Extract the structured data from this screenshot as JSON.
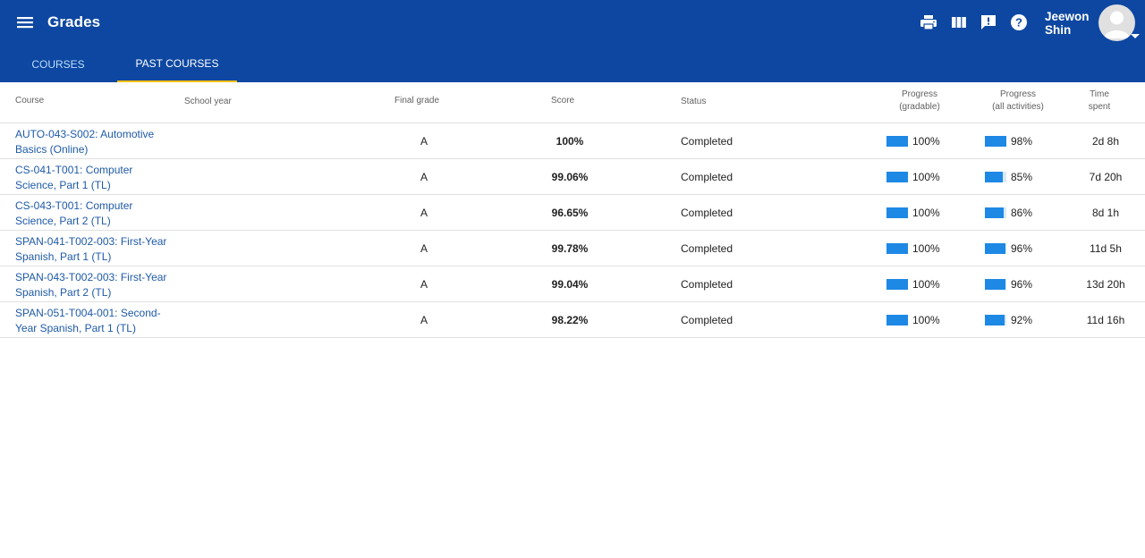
{
  "app": {
    "title": "Grades"
  },
  "header": {
    "icons": [
      "menu-icon",
      "print-icon",
      "columns-icon",
      "feedback-icon",
      "help-icon"
    ],
    "user": {
      "name_line1": "Jeewon",
      "name_line2": "Shin"
    }
  },
  "tabs": [
    {
      "label": "COURSES",
      "active": false
    },
    {
      "label": "PAST COURSES",
      "active": true
    }
  ],
  "columns": {
    "course": "Course",
    "school_year": "School year",
    "final_grade": "Final grade",
    "score": "Score",
    "status": "Status",
    "progress_gradable_1": "Progress",
    "progress_gradable_2": "(gradable)",
    "progress_all_1": "Progress",
    "progress_all_2": "(all activities)",
    "time_1": "Time",
    "time_2": "spent"
  },
  "rows": [
    {
      "course": "AUTO-043-S002: Automotive Basics (Online)",
      "grade": "A",
      "score": "100%",
      "status": "Completed",
      "prog_gradable": "100%",
      "prog_gradable_value": 100,
      "prog_all": "98%",
      "prog_all_value": 98,
      "time": "2d 8h"
    },
    {
      "course": "CS-041-T001: Computer Science, Part 1 (TL)",
      "grade": "A",
      "score": "99.06%",
      "status": "Completed",
      "prog_gradable": "100%",
      "prog_gradable_value": 100,
      "prog_all": "85%",
      "prog_all_value": 85,
      "time": "7d 20h"
    },
    {
      "course": "CS-043-T001: Computer Science, Part 2 (TL)",
      "grade": "A",
      "score": "96.65%",
      "status": "Completed",
      "prog_gradable": "100%",
      "prog_gradable_value": 100,
      "prog_all": "86%",
      "prog_all_value": 86,
      "time": "8d 1h"
    },
    {
      "course": "SPAN-041-T002-003: First-Year Spanish, Part 1 (TL)",
      "grade": "A",
      "score": "99.78%",
      "status": "Completed",
      "prog_gradable": "100%",
      "prog_gradable_value": 100,
      "prog_all": "96%",
      "prog_all_value": 96,
      "time": "11d 5h"
    },
    {
      "course": "SPAN-043-T002-003: First-Year Spanish, Part 2 (TL)",
      "grade": "A",
      "score": "99.04%",
      "status": "Completed",
      "prog_gradable": "100%",
      "prog_gradable_value": 100,
      "prog_all": "96%",
      "prog_all_value": 96,
      "time": "13d 20h"
    },
    {
      "course": "SPAN-051-T004-001: Second-Year Spanish, Part 1 (TL)",
      "grade": "A",
      "score": "98.22%",
      "status": "Completed",
      "prog_gradable": "100%",
      "prog_gradable_value": 100,
      "prog_all": "92%",
      "prog_all_value": 92,
      "time": "11d 16h"
    }
  ],
  "colors": {
    "header_bg": "#0d47a1",
    "tab_indicator": "#ffc107",
    "progress_fill": "#1e88e5",
    "link": "#1f5aa8"
  }
}
